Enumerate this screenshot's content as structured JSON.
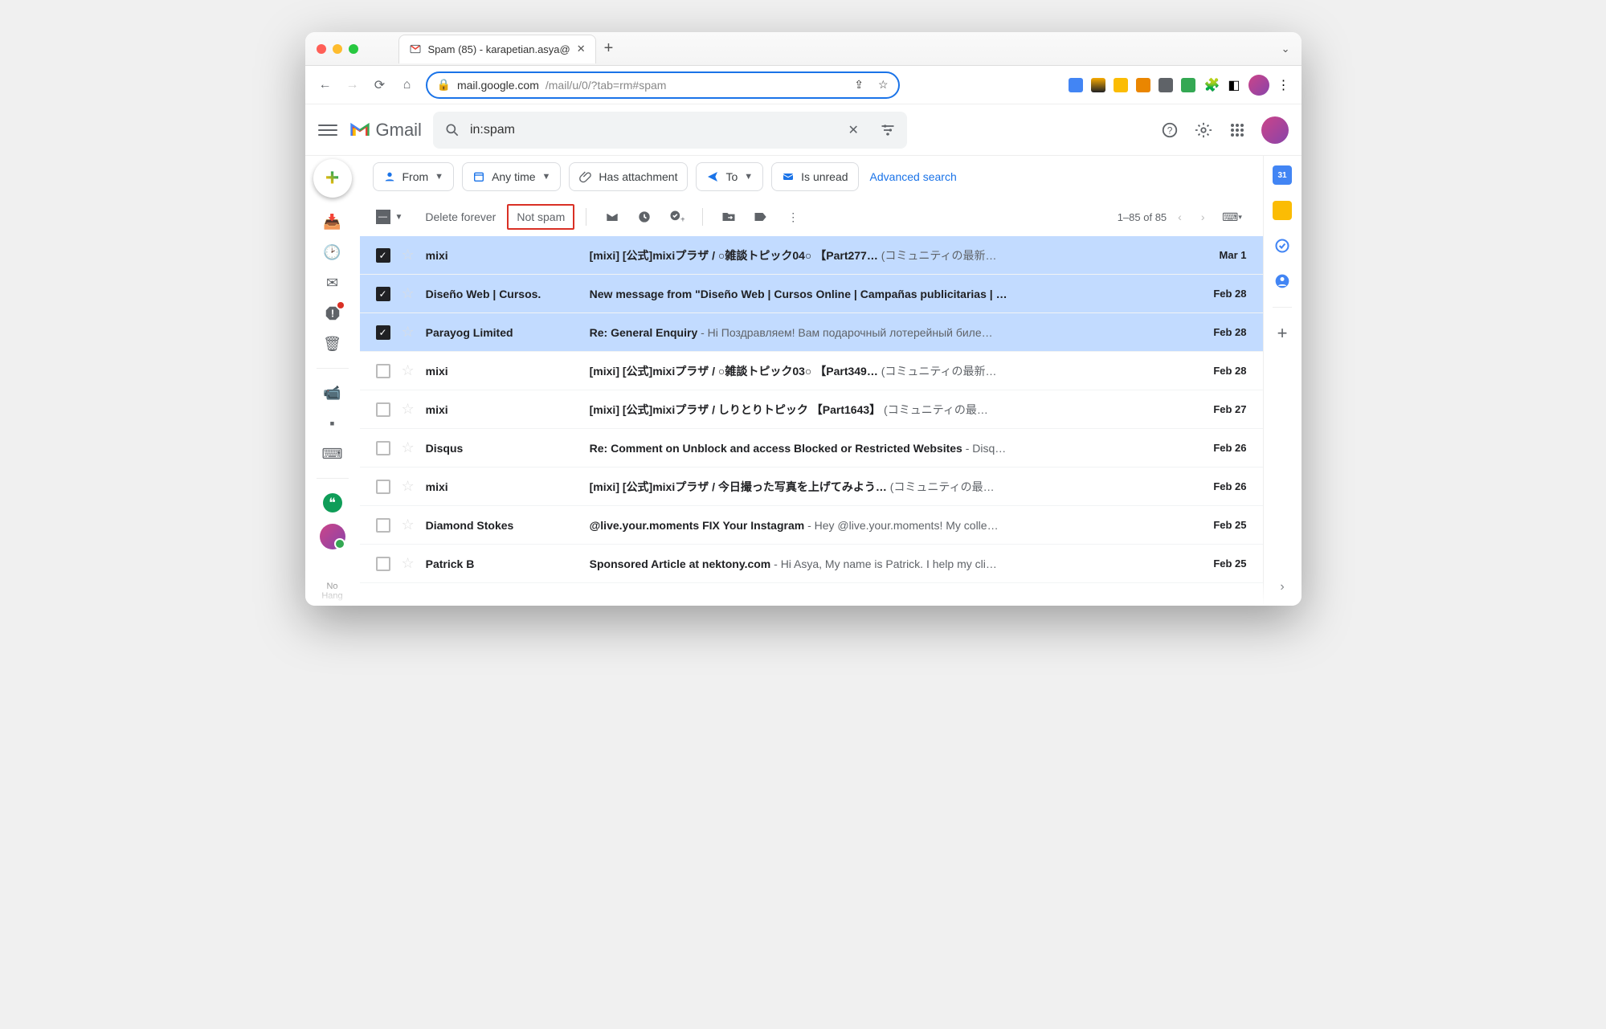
{
  "browser": {
    "tab_title": "Spam (85) - karapetian.asya@",
    "url_host": "mail.google.com",
    "url_path": "/mail/u/0/?tab=rm#spam"
  },
  "gmail": {
    "brand": "Gmail",
    "search_value": "in:spam"
  },
  "chips": {
    "from": "From",
    "anytime": "Any time",
    "attachment": "Has attachment",
    "to": "To",
    "unread": "Is unread",
    "advanced": "Advanced search"
  },
  "toolbar": {
    "delete_forever": "Delete forever",
    "not_spam": "Not spam",
    "count": "1–85 of 85"
  },
  "messages": [
    {
      "checked": true,
      "sender": "mixi",
      "subject": "[mixi] [公式]mixiプラザ / ○雑談トピック04○ 【Part277…",
      "preview": " (コミュニティの最新…",
      "date": "Mar 1"
    },
    {
      "checked": true,
      "sender": "Diseño Web | Cursos.",
      "subject": "New message from \"Diseño Web | Cursos Online | Campañas publicitarias | …",
      "preview": "",
      "date": "Feb 28"
    },
    {
      "checked": true,
      "sender": "Parayog Limited",
      "subject": "Re: General Enquiry",
      "preview": " - Hi Поздравляем! Вам подарочный лотерейный биле…",
      "date": "Feb 28"
    },
    {
      "checked": false,
      "sender": "mixi",
      "subject": "[mixi] [公式]mixiプラザ / ○雑談トピック03○ 【Part349…",
      "preview": " (コミュニティの最新…",
      "date": "Feb 28"
    },
    {
      "checked": false,
      "sender": "mixi",
      "subject": "[mixi] [公式]mixiプラザ / しりとりトピック 【Part1643】",
      "preview": " (コミュニティの最…",
      "date": "Feb 27"
    },
    {
      "checked": false,
      "sender": "Disqus",
      "subject": "Re: Comment on Unblock and access Blocked or Restricted Websites",
      "preview": " - Disq…",
      "date": "Feb 26"
    },
    {
      "checked": false,
      "sender": "mixi",
      "subject": "[mixi] [公式]mixiプラザ / 今日撮った写真を上げてみよう…",
      "preview": " (コミュニティの最…",
      "date": "Feb 26"
    },
    {
      "checked": false,
      "sender": "Diamond Stokes",
      "subject": "@live.your.moments FIX Your Instagram",
      "preview": " - Hey @live.your.moments! My colle…",
      "date": "Feb 25"
    },
    {
      "checked": false,
      "sender": "Patrick B",
      "subject": "Sponsored Article at nektony.com",
      "preview": " - Hi Asya, My name is Patrick. I help my cli…",
      "date": "Feb 25"
    }
  ],
  "hangouts_label": "No\nHang"
}
